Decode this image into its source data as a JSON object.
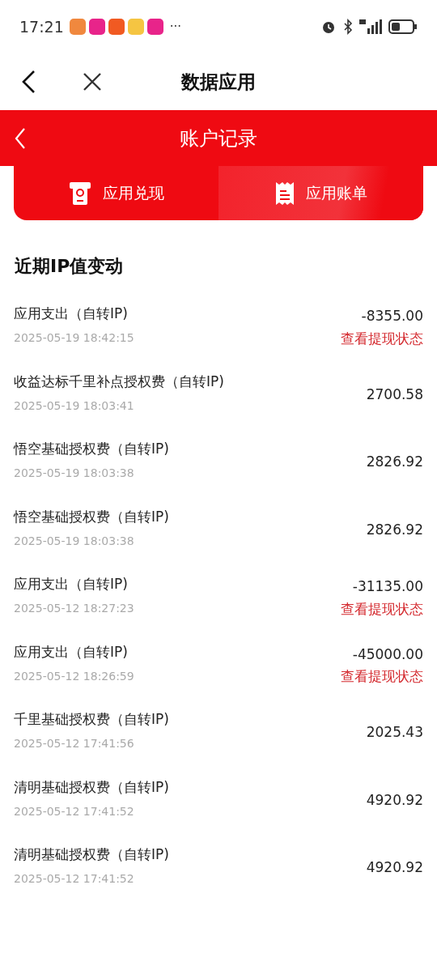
{
  "status_bar": {
    "time": "17:21",
    "more": "···"
  },
  "nav": {
    "title": "数据应用"
  },
  "header": {
    "title": "账户记录"
  },
  "tabs": [
    {
      "label": "应用兑现",
      "selected": false
    },
    {
      "label": "应用账单",
      "selected": true
    }
  ],
  "section_title": "近期IP值变动",
  "records": [
    {
      "title": "应用支出（自转IP)",
      "time": "2025-05-19 18:42:15",
      "amount": "-8355.00",
      "link": "查看提现状态"
    },
    {
      "title": "收益达标千里补点授权费（自转IP)",
      "time": "2025-05-19 18:03:41",
      "amount": "2700.58"
    },
    {
      "title": "悟空基础授权费（自转IP)",
      "time": "2025-05-19 18:03:38",
      "amount": "2826.92"
    },
    {
      "title": "悟空基础授权费（自转IP)",
      "time": "2025-05-19 18:03:38",
      "amount": "2826.92"
    },
    {
      "title": "应用支出（自转IP)",
      "time": "2025-05-12 18:27:23",
      "amount": "-31135.00",
      "link": "查看提现状态"
    },
    {
      "title": "应用支出（自转IP)",
      "time": "2025-05-12 18:26:59",
      "amount": "-45000.00",
      "link": "查看提现状态"
    },
    {
      "title": "千里基础授权费（自转IP)",
      "time": "2025-05-12 17:41:56",
      "amount": "2025.43"
    },
    {
      "title": "清明基础授权费（自转IP)",
      "time": "2025-05-12 17:41:52",
      "amount": "4920.92"
    },
    {
      "title": "清明基础授权费（自转IP)",
      "time": "2025-05-12 17:41:52",
      "amount": "4920.92"
    }
  ]
}
